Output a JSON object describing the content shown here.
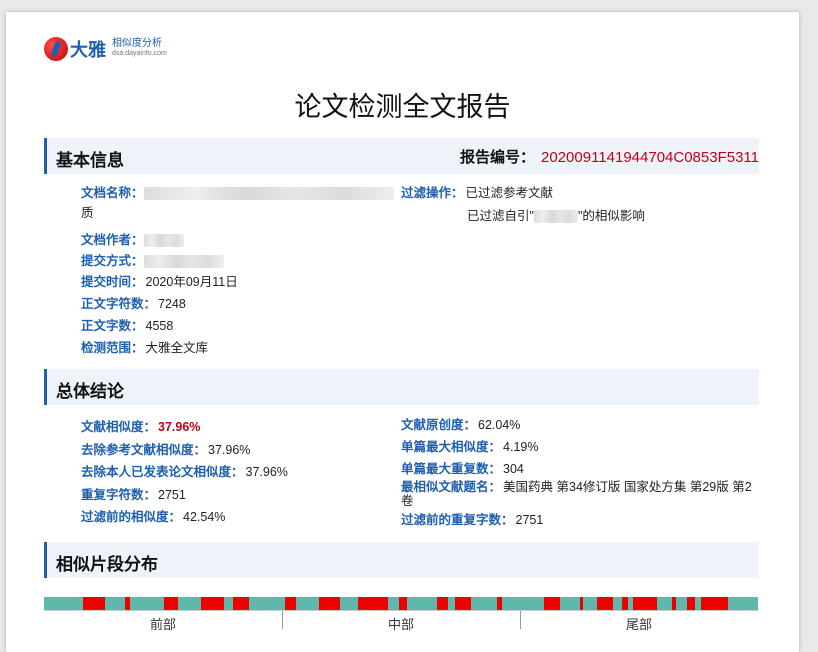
{
  "brand": {
    "name": "大雅",
    "subtitle": "相似度分析",
    "domain": "dsa.dayainfo.com"
  },
  "title": "论文检测全文报告",
  "basic": {
    "header": "基本信息",
    "report_no_label": "报告编号：",
    "report_no": "2020091141944704C0853F5311",
    "doc_name_label": "文档名称：",
    "doc_name_tail": "质",
    "author_label": "文档作者：",
    "submit_method_label": "提交方式：",
    "submit_time_label": "提交时间：",
    "submit_time": "2020年09月11日",
    "char_count_label": "正文字符数：",
    "char_count": "7248",
    "word_count_label": "正文字数：",
    "word_count": "4558",
    "scope_label": "检测范围：",
    "scope": "大雅全文库",
    "filter_label": "过滤操作：",
    "filter_1": "已过滤参考文献",
    "filter_2_prefix": "已过滤自引\"",
    "filter_2_suffix": "\"的相似影响"
  },
  "summary": {
    "header": "总体结论",
    "sim_label": "文献相似度：",
    "sim": "37.96%",
    "no_ref_label": "去除参考文献相似度：",
    "no_ref": "37.96%",
    "no_self_label": "去除本人已发表论文相似度：",
    "no_self": "37.96%",
    "dup_chars_label": "重复字符数：",
    "dup_chars": "2751",
    "pre_filter_label": "过滤前的相似度：",
    "pre_filter": "42.54%",
    "originality_label": "文献原创度：",
    "originality": "62.04%",
    "max_single_label": "单篇最大相似度：",
    "max_single": "4.19%",
    "max_dup_label": "单篇最大重复数：",
    "max_dup": "304",
    "most_similar_label": "最相似文献题名：",
    "most_similar": "美国药典 第34修订版 国家处方集 第29版 第2卷",
    "pre_filter_dup_label": "过滤前的重复字数：",
    "pre_filter_dup": "2751"
  },
  "distribution": {
    "header": "相似片段分布",
    "labels": [
      "前部",
      "中部",
      "尾部"
    ],
    "colors": {
      "match": "#ee0000",
      "clean": "#5fb8ac"
    },
    "segments": [
      [
        0.055,
        0.085
      ],
      [
        0.113,
        0.12
      ],
      [
        0.168,
        0.187
      ],
      [
        0.22,
        0.252
      ],
      [
        0.265,
        0.287
      ],
      [
        0.338,
        0.353
      ],
      [
        0.385,
        0.415
      ],
      [
        0.44,
        0.482
      ],
      [
        0.497,
        0.509
      ],
      [
        0.55,
        0.566
      ],
      [
        0.575,
        0.598
      ],
      [
        0.635,
        0.642
      ],
      [
        0.7,
        0.722
      ],
      [
        0.75,
        0.755
      ],
      [
        0.775,
        0.797
      ],
      [
        0.81,
        0.818
      ],
      [
        0.825,
        0.858
      ],
      [
        0.88,
        0.885
      ],
      [
        0.9,
        0.912
      ],
      [
        0.92,
        0.958
      ]
    ]
  }
}
